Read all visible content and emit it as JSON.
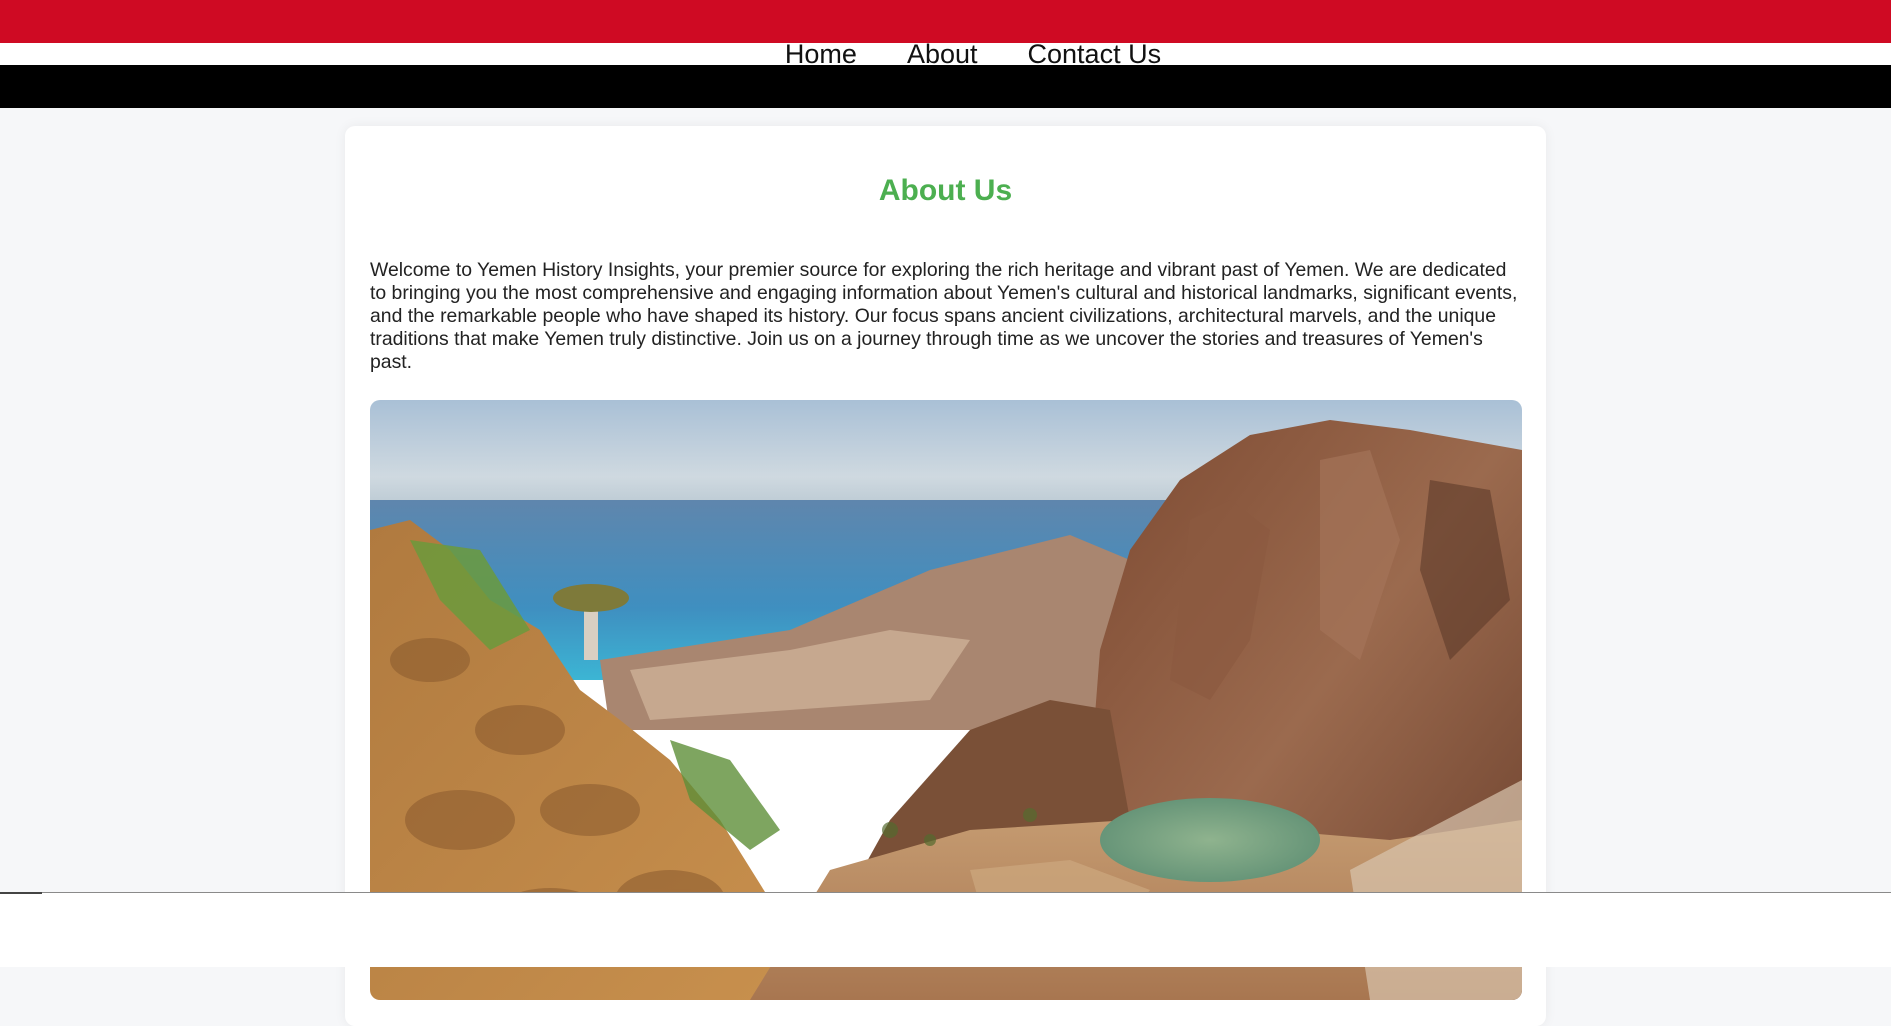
{
  "nav": {
    "items": [
      {
        "label": "Home"
      },
      {
        "label": "About"
      },
      {
        "label": "Contact Us"
      }
    ]
  },
  "about": {
    "title": "About Us",
    "intro": "Welcome to Yemen History Insights, your premier source for exploring the rich heritage and vibrant past of Yemen. We are dedicated to bringing you the most comprehensive and engaging information about Yemen's cultural and historical landmarks, significant events, and the remarkable people who have shaped its history. Our focus spans ancient civilizations, architectural marvels, and the unique traditions that make Yemen truly distinctive. Join us on a journey through time as we uncover the stories and treasures of Yemen's past."
  },
  "colors": {
    "flag_red": "#cf0a23",
    "flag_white": "#ffffff",
    "flag_black": "#000000",
    "accent_green": "#4caf50",
    "page_bg": "#f6f7f9"
  }
}
